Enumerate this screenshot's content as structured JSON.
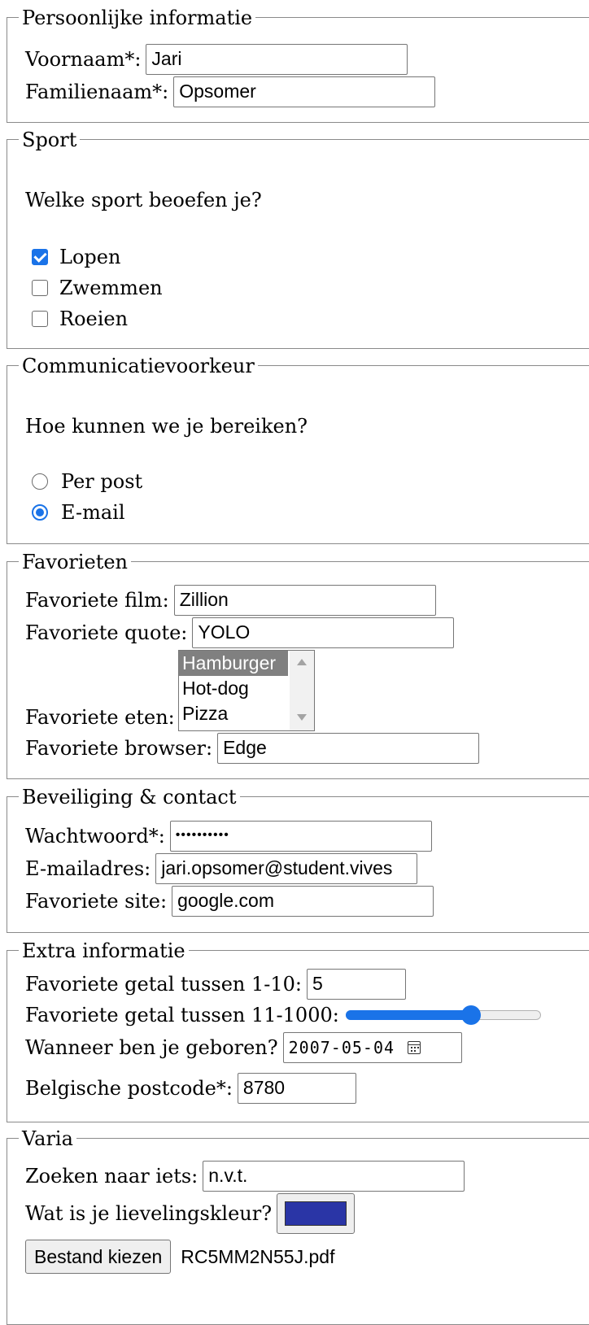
{
  "personal": {
    "legend": "Persoonlijke informatie",
    "firstname_label": "Voornaam*:",
    "firstname_value": "Jari",
    "lastname_label": "Familienaam*:",
    "lastname_value": "Opsomer"
  },
  "sport": {
    "legend": "Sport",
    "question": "Welke sport beoefen je?",
    "options": [
      {
        "label": "Lopen",
        "checked": true
      },
      {
        "label": "Zwemmen",
        "checked": false
      },
      {
        "label": "Roeien",
        "checked": false
      }
    ]
  },
  "communication": {
    "legend": "Communicatievoorkeur",
    "question": "Hoe kunnen we je bereiken?",
    "options": [
      {
        "label": "Per post",
        "selected": false
      },
      {
        "label": "E-mail",
        "selected": true
      }
    ]
  },
  "favorites": {
    "legend": "Favorieten",
    "film_label": "Favoriete film:",
    "film_value": "Zillion",
    "quote_label": "Favoriete quote:",
    "quote_value": "YOLO",
    "food_label": "Favoriete eten:",
    "food_options": [
      "Hamburger",
      "Hot-dog",
      "Pizza"
    ],
    "food_selected": "Hamburger",
    "browser_label": "Favoriete browser:",
    "browser_value": "Edge"
  },
  "security": {
    "legend": "Beveiliging & contact",
    "password_label": "Wachtwoord*:",
    "password_mask": "••••••••••",
    "email_label": "E-mailadres:",
    "email_value": "jari.opsomer@student.vives",
    "site_label": "Favoriete site:",
    "site_value": "google.com"
  },
  "extra": {
    "legend": "Extra informatie",
    "number_label": "Favoriete getal tussen 1-10:",
    "number_value": "5",
    "range_label": "Favoriete getal tussen 11-1000:",
    "range_fraction": 0.66,
    "birth_label": "Wanneer ben je geboren?",
    "birth_value": "2007-05-04",
    "postcode_label": "Belgische postcode*:",
    "postcode_value": "8780"
  },
  "misc": {
    "legend": "Varia",
    "search_label": "Zoeken naar iets:",
    "search_value": "n.v.t.",
    "color_label": "Wat is je lievelingskleur?",
    "color_value": "#2a35a6",
    "file_button": "Bestand kiezen",
    "file_name": "RC5MM2N55J.pdf"
  },
  "colors": {
    "accent": "#1a73e8",
    "border": "#8a8a8a"
  }
}
